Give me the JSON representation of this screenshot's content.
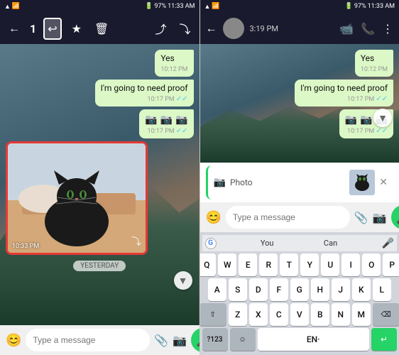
{
  "left_panel": {
    "status_bar": {
      "time": "11:33 AM",
      "battery": "97%",
      "signal": "4G"
    },
    "toolbar": {
      "back_label": "←",
      "count": "1",
      "reply_label": "↩",
      "star_label": "★",
      "delete_label": "🗑",
      "share_label": "⤴",
      "forward_label": "⤵"
    },
    "messages": [
      {
        "text": "Yes",
        "time": "10:12 PM",
        "type": "outgoing"
      },
      {
        "text": "I'm going to need proof",
        "time": "10:17 PM",
        "type": "outgoing",
        "ticks": "✓✓"
      },
      {
        "camera": true,
        "time": "10:17 PM",
        "type": "outgoing",
        "ticks": "✓✓"
      },
      {
        "image": "cat",
        "time": "10:33 PM",
        "type": "incoming"
      }
    ],
    "yesterday_badge": "YESTERDAY",
    "scroll_arrow": "▼",
    "input_bar": {
      "emoji_icon": "😊",
      "placeholder": "Type a message",
      "attach_icon": "📎",
      "camera_icon": "📷",
      "mic_icon": "🎤"
    }
  },
  "right_panel": {
    "status_bar": {
      "time": "11:33 AM",
      "battery": "97%",
      "signal": "4G"
    },
    "header": {
      "time": "3:19 PM",
      "video_icon": "📹",
      "call_icon": "📞",
      "menu_icon": "⋮"
    },
    "messages": [
      {
        "text": "Yes",
        "time": "10:12 PM",
        "type": "outgoing"
      },
      {
        "text": "I'm going to need proof",
        "time": "10:17 PM",
        "type": "outgoing",
        "ticks": "✓✓"
      },
      {
        "camera": true,
        "time": "10:17 PM",
        "type": "outgoing",
        "ticks": "✓✓"
      }
    ],
    "scroll_arrow": "▼",
    "reply_preview": {
      "camera_icon": "📷",
      "label": "Photo",
      "close_icon": "✕"
    },
    "input_bar": {
      "emoji_icon": "😊",
      "placeholder": "Type a message",
      "attach_icon": "📎",
      "camera_icon": "📷",
      "mic_icon": "🎤"
    },
    "keyboard": {
      "suggestions": [
        "You",
        "Can"
      ],
      "mic_icon": "🎤",
      "rows": [
        [
          "Q",
          "W",
          "E",
          "R",
          "T",
          "Y",
          "U",
          "I",
          "O",
          "P"
        ],
        [
          "A",
          "S",
          "D",
          "F",
          "G",
          "H",
          "J",
          "K",
          "L"
        ],
        [
          "Z",
          "X",
          "C",
          "V",
          "B",
          "N",
          "M"
        ]
      ],
      "special_123": "?123",
      "emoji_key": "☺",
      "language": "EN·",
      "enter_icon": "↵"
    }
  }
}
